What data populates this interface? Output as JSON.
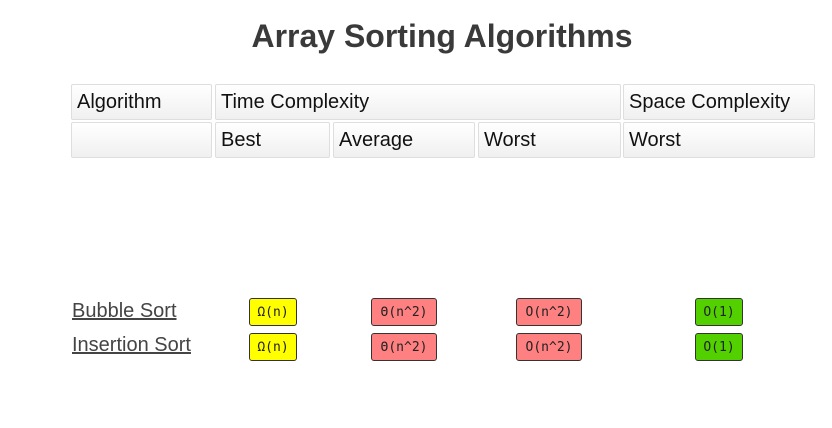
{
  "title": "Array Sorting Algorithms",
  "header": {
    "algorithm": "Algorithm",
    "time_complexity": "Time Complexity",
    "space_complexity": "Space Complexity",
    "best": "Best",
    "average": "Average",
    "worst": "Worst",
    "space_worst": "Worst"
  },
  "colors": {
    "good": "#ffff00",
    "bad": "#ff8080",
    "excellent": "#53d000"
  },
  "rows": [
    {
      "name": "Bubble Sort",
      "best": "Ω(n)",
      "average": "Θ(n^2)",
      "worst": "O(n^2)",
      "space": "O(1)"
    },
    {
      "name": "Insertion Sort",
      "best": "Ω(n)",
      "average": "Θ(n^2)",
      "worst": "O(n^2)",
      "space": "O(1)"
    }
  ]
}
